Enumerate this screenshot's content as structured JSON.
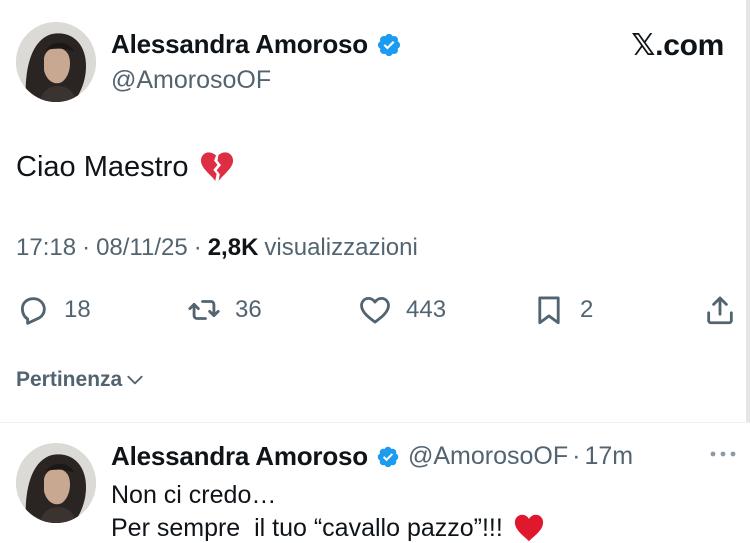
{
  "tweet": {
    "author_name": "Alessandra Amoroso",
    "author_handle": "@AmorosoOF",
    "source_label": "𝕏.com",
    "text": "Ciao Maestro",
    "text_emoji": "broken-heart-icon",
    "time": "17:18",
    "date": "08/11/25",
    "views_count": "2,8K",
    "views_label": "visualizzazioni",
    "separator": "·",
    "replies": "18",
    "retweets": "36",
    "likes": "443",
    "bookmarks": "2"
  },
  "sort": {
    "label": "Pertinenza"
  },
  "reply": {
    "author_name": "Alessandra Amoroso",
    "author_handle": "@AmorosoOF",
    "separator": "·",
    "time": "17m",
    "line1": "Non ci credo…",
    "line2": "Per sempre  il tuo “cavallo pazzo”!!!",
    "line2_emoji": "red-heart-icon"
  },
  "colors": {
    "verified_blue": "#1d9bf0",
    "text_primary": "#0f1419",
    "text_secondary": "#536471",
    "heart_red": "#e0182d"
  }
}
